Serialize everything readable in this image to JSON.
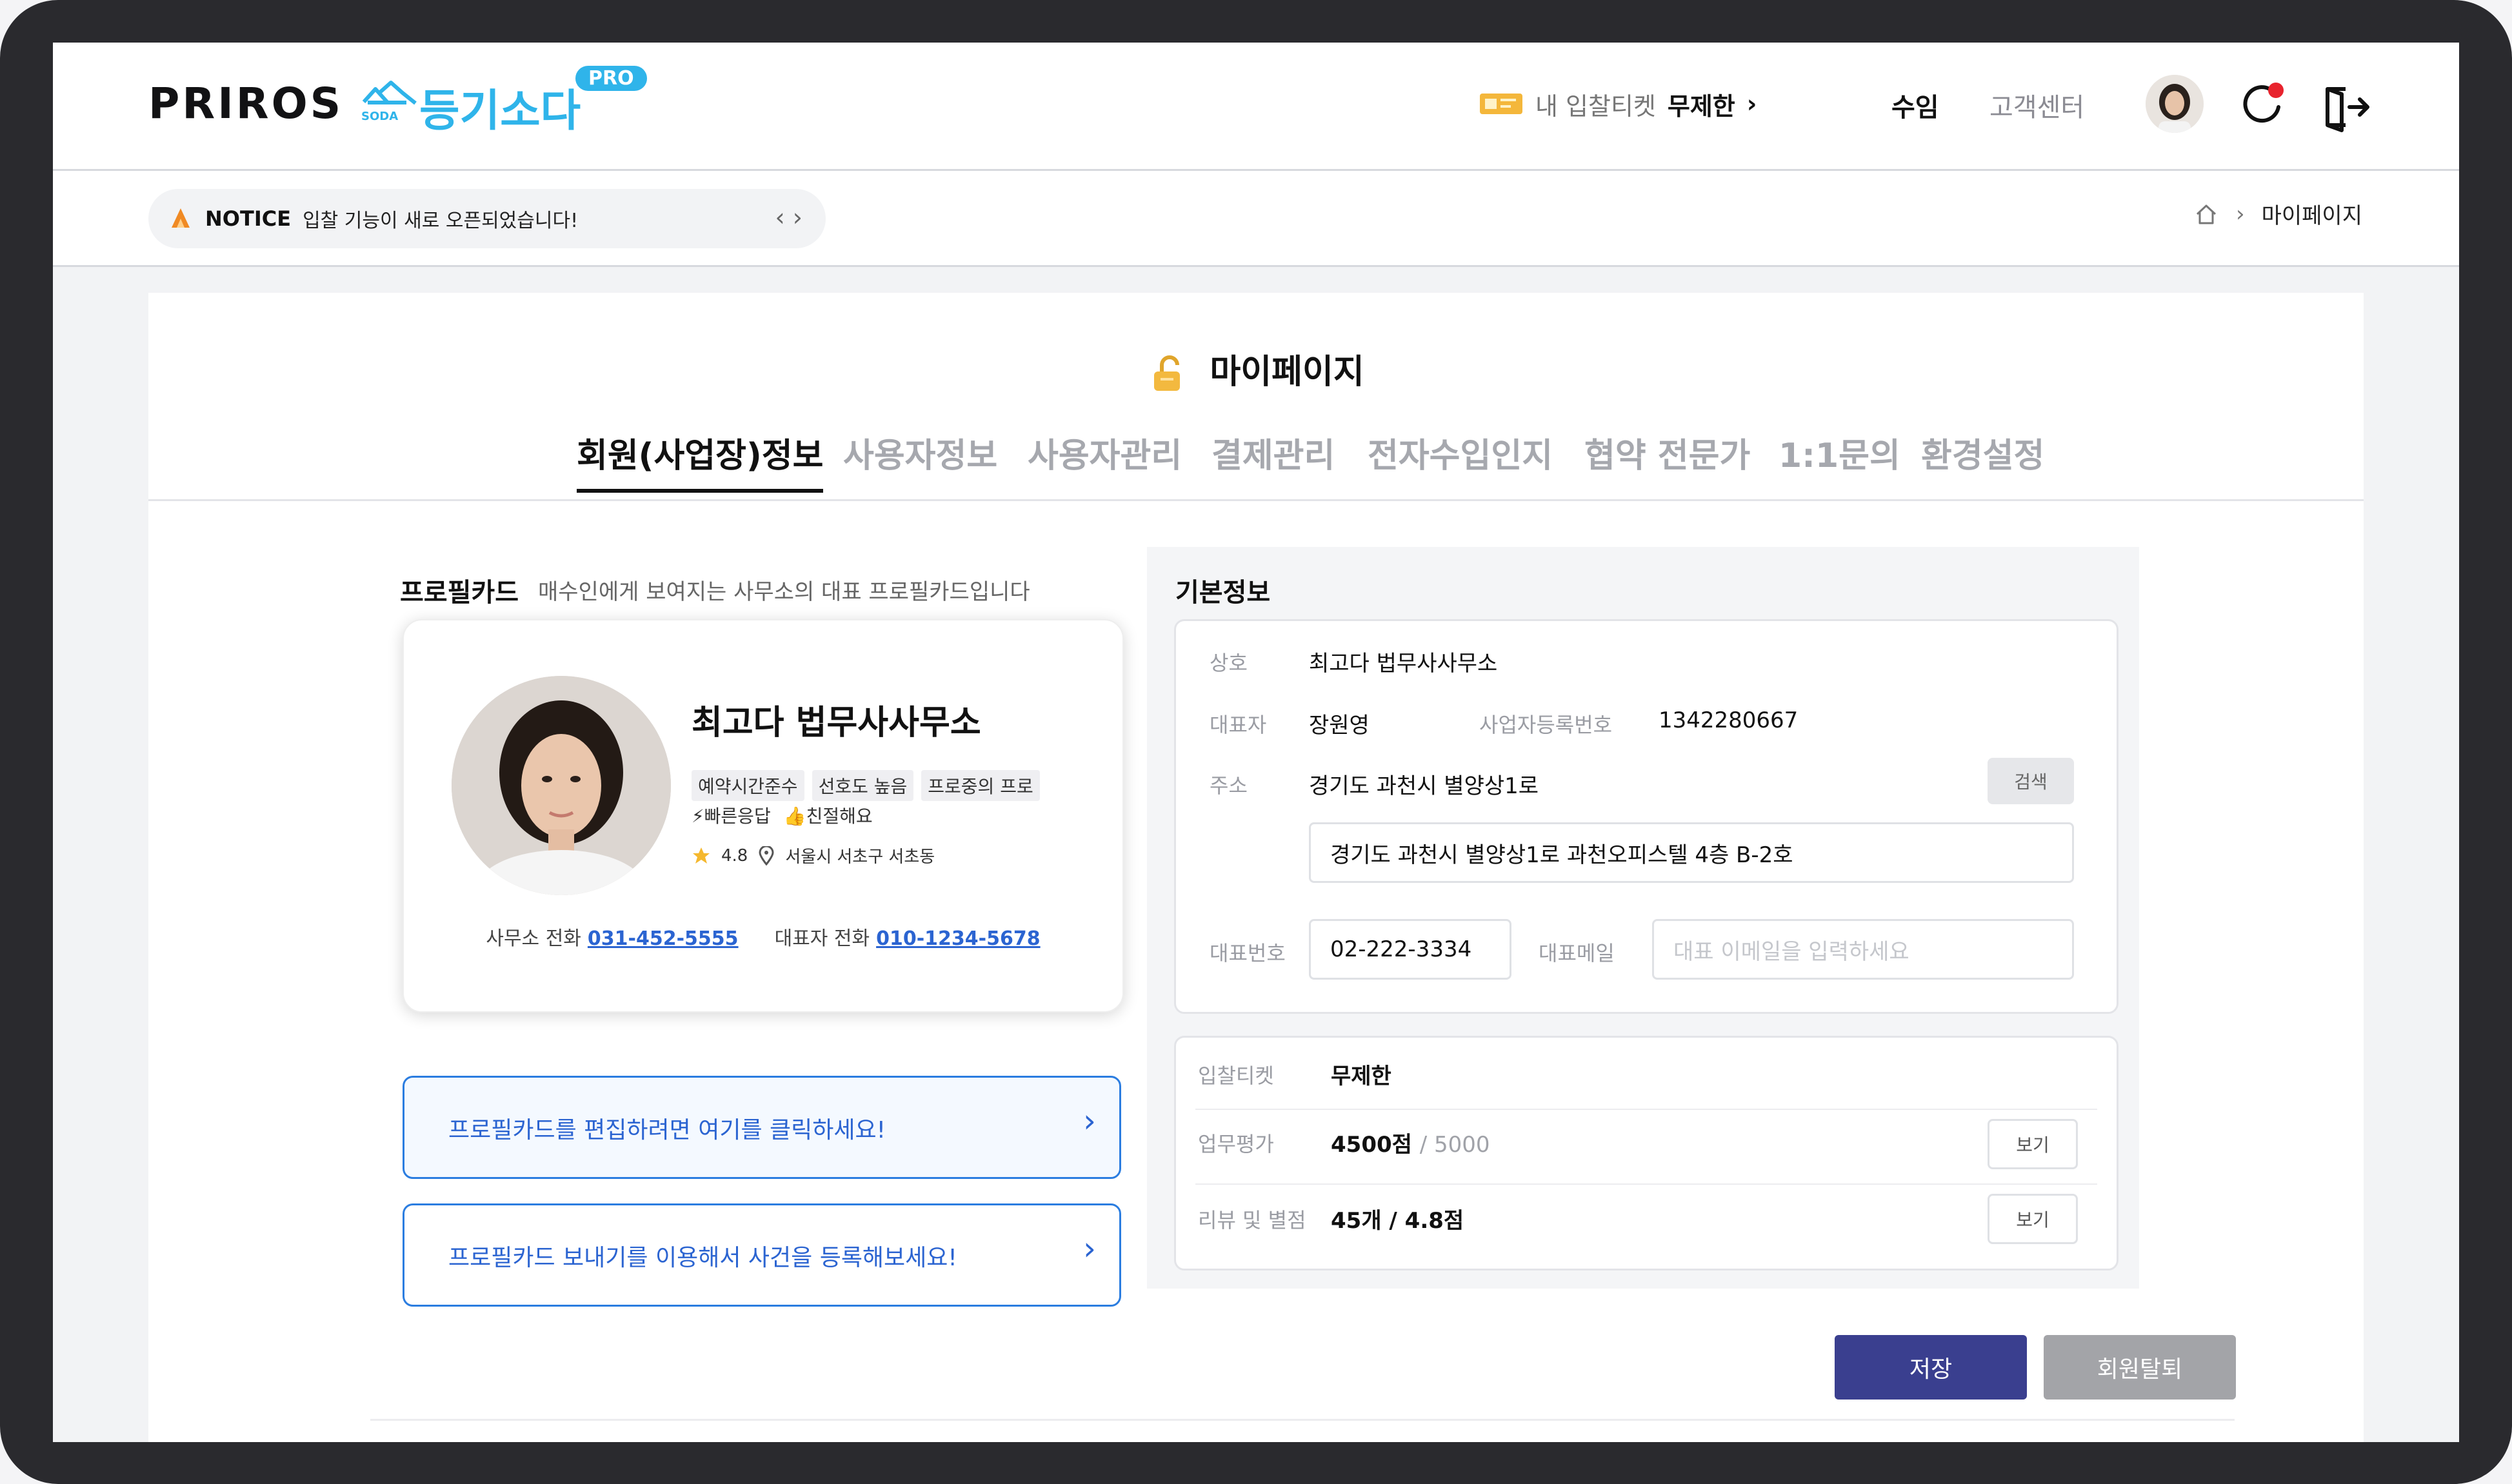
{
  "header": {
    "logo_text": "PRIROS",
    "service_name": "등기소다",
    "service_sub": "SODA",
    "pro_badge": "PRO",
    "ticket_label": "내 입찰티켓",
    "ticket_value": "무제한",
    "ticket_chevron": "›",
    "nav_suim": "수임",
    "nav_cs": "고객센터",
    "accent_color": "#2fb4ea"
  },
  "notice": {
    "label": "NOTICE",
    "text": "입찰 기능이 새로 오픈되었습니다!",
    "arrows": "‹ ›"
  },
  "breadcrumb": {
    "separator": "›",
    "current": "마이페이지"
  },
  "page": {
    "title": "마이페이지",
    "tabs": [
      {
        "label": "회원(사업장)정보"
      },
      {
        "label": "사용자정보"
      },
      {
        "label": "사용자관리"
      },
      {
        "label": "결제관리"
      },
      {
        "label": "전자수입인지"
      },
      {
        "label": "협약 전문가"
      },
      {
        "label": "1:1문의"
      },
      {
        "label": "환경설정"
      }
    ]
  },
  "profile_card": {
    "section_title": "프로필카드",
    "section_sub": "매수인에게 보여지는 사무소의 대표 프로필카드입니다",
    "office_name": "최고다 법무사사무소",
    "tags": [
      "예약시간준수",
      "선호도 높음",
      "프로중의 프로"
    ],
    "tags2": [
      "⚡빠른응답",
      "👍친절해요"
    ],
    "rating": "4.8",
    "location": "서울시 서초구 서초동",
    "office_phone_label": "사무소 전화",
    "office_phone": "031-452-5555",
    "rep_phone_label": "대표자 전화",
    "rep_phone": "010-1234-5678",
    "edit_link": "프로필카드를 편집하려면 여기를 클릭하세요!",
    "send_link": "프로필카드 보내기를 이용해서 사건을 등록해보세요!",
    "link_arrow": "›"
  },
  "basic_info": {
    "section_title": "기본정보",
    "company_label": "상호",
    "company": "최고다 법무사사무소",
    "rep_label": "대표자",
    "rep": "장원영",
    "bizno_label": "사업자등록번호",
    "bizno": "1342280667",
    "address_label": "주소",
    "address": "경기도 과천시 별양상1로",
    "search_button": "검색",
    "address_detail": "경기도 과천시 별양상1로 과천오피스텔 4층 B-2호",
    "phone_label": "대표번호",
    "phone": "02-222-3334",
    "email_label": "대표메일",
    "email_placeholder": "대표 이메일을 입력하세요"
  },
  "stats": {
    "ticket_label": "입찰티켓",
    "ticket_value": "무제한",
    "eval_label": "업무평가",
    "eval_value": "4500점",
    "eval_max": "/ 5000",
    "review_label": "리뷰 및 별점",
    "review_value": "45개 / 4.8점",
    "view_button": "보기"
  },
  "actions": {
    "save": "저장",
    "withdraw": "회원탈퇴"
  }
}
